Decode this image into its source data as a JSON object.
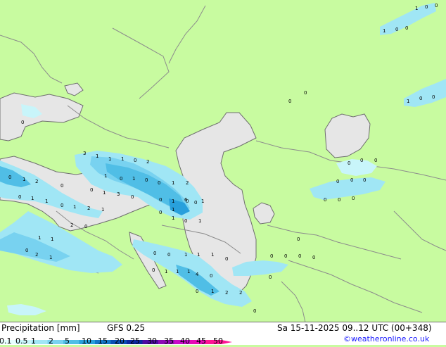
{
  "header": {
    "title": "Precipitation [mm]",
    "model": "GFS 0.25",
    "datetime": "Sa 15-11-2025 09..12 UTC (00+348)",
    "copyright": "©weatheronline.co.uk"
  },
  "legend": {
    "ticks": [
      "0.1",
      "0.5",
      "1",
      "2",
      "5",
      "10",
      "15",
      "20",
      "25",
      "30",
      "35",
      "40",
      "45",
      "50"
    ],
    "colors": [
      "#e6ffff",
      "#c8f5fa",
      "#a0e6f5",
      "#78d2f0",
      "#50bee6",
      "#28a0dc",
      "#1478c8",
      "#0a50b4",
      "#0a28a0",
      "#4b0aa0",
      "#8c0ab4",
      "#c80ac8",
      "#e60ab4",
      "#ff1493"
    ]
  },
  "map": {
    "colors": {
      "land": "#c8fba0",
      "sea": "#e6e6e6",
      "border": "#8c8c8c",
      "coast": "#6e6e6e"
    },
    "values": [
      "0",
      "1",
      "2",
      "0",
      "1",
      "1",
      "0",
      "1",
      "0",
      "2",
      "1",
      "3",
      "1",
      "1",
      "1",
      "0",
      "2",
      "1",
      "0",
      "1",
      "0",
      "0",
      "1",
      "2",
      "0",
      "1",
      "3",
      "0",
      "0",
      "1",
      "0",
      "0",
      "1",
      "6",
      "1",
      "0",
      "1",
      "0",
      "1",
      "2",
      "0",
      "1",
      "1",
      "0",
      "2",
      "1",
      "0",
      "0",
      "1",
      "1",
      "1",
      "0",
      "1",
      "1",
      "1",
      "4",
      "0",
      "0",
      "1",
      "2",
      "2",
      "0",
      "0",
      "0",
      "0",
      "0",
      "0",
      "0",
      "0",
      "0",
      "0",
      "0",
      "0",
      "0",
      "0",
      "0",
      "0",
      "0",
      "0",
      "0",
      "1",
      "0",
      "0",
      "1",
      "0",
      "0",
      "1",
      "0",
      "0",
      "0"
    ]
  }
}
